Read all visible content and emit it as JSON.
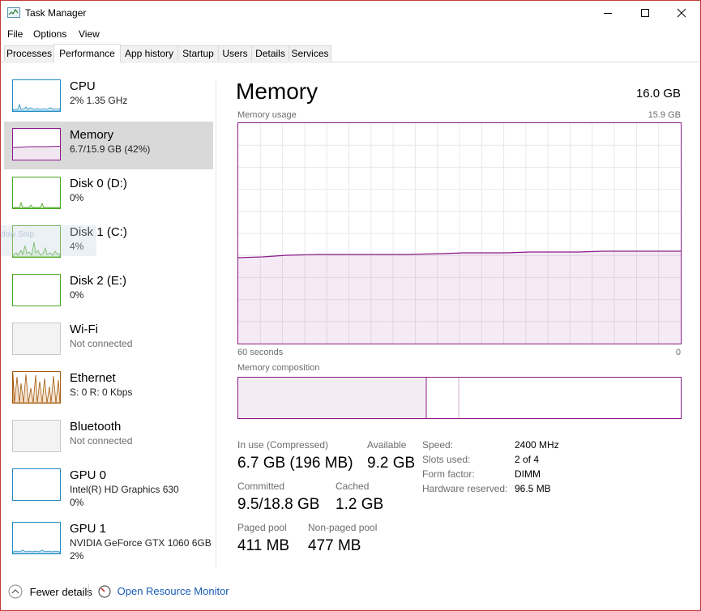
{
  "window": {
    "title": "Task Manager"
  },
  "menu": [
    "File",
    "Options",
    "View"
  ],
  "tabs": [
    "Processes",
    "Performance",
    "App history",
    "Startup",
    "Users",
    "Details",
    "Services"
  ],
  "active_tab": "Performance",
  "sidebar": {
    "items": [
      {
        "name": "CPU",
        "sub": "2% 1.35 GHz"
      },
      {
        "name": "Memory",
        "sub": "6.7/15.9 GB (42%)"
      },
      {
        "name": "Disk 0 (D:)",
        "sub": "0%"
      },
      {
        "name": "Disk 1 (C:)",
        "sub": "4%"
      },
      {
        "name": "Disk 2 (E:)",
        "sub": "0%"
      },
      {
        "name": "Wi-Fi",
        "sub": "Not connected"
      },
      {
        "name": "Ethernet",
        "sub": "S: 0 R: 0 Kbps"
      },
      {
        "name": "Bluetooth",
        "sub": "Not connected"
      },
      {
        "name": "GPU 0",
        "sub": "Intel(R) HD Graphics 630",
        "sub2": "0%"
      },
      {
        "name": "GPU 1",
        "sub": "NVIDIA GeForce GTX 1060 6GB",
        "sub2": "2%"
      }
    ],
    "overlay_text": "dow Snip"
  },
  "main": {
    "title": "Memory",
    "total": "16.0 GB",
    "usage_label": "Memory usage",
    "usage_max": "15.9 GB",
    "time_left": "60 seconds",
    "time_right": "0",
    "composition_label": "Memory composition",
    "stats": {
      "in_use_label": "In use (Compressed)",
      "in_use_value": "6.7 GB (196 MB)",
      "available_label": "Available",
      "available_value": "9.2 GB",
      "committed_label": "Committed",
      "committed_value": "9.5/18.8 GB",
      "cached_label": "Cached",
      "cached_value": "1.2 GB",
      "paged_label": "Paged pool",
      "paged_value": "411 MB",
      "nonpaged_label": "Non-paged pool",
      "nonpaged_value": "477 MB"
    },
    "details": {
      "speed_label": "Speed:",
      "speed_value": "2400 MHz",
      "slots_label": "Slots used:",
      "slots_value": "2 of 4",
      "form_label": "Form factor:",
      "form_value": "DIMM",
      "hw_label": "Hardware reserved:",
      "hw_value": "96.5 MB"
    }
  },
  "footer": {
    "fewer_details": "Fewer details",
    "open_monitor": "Open Resource Monitor"
  },
  "colors": {
    "memory": "#8b1a8b",
    "cpu": "#1e8bc3",
    "disk": "#4aa823",
    "ethernet": "#a6580b",
    "link": "#1a5bb5"
  }
}
